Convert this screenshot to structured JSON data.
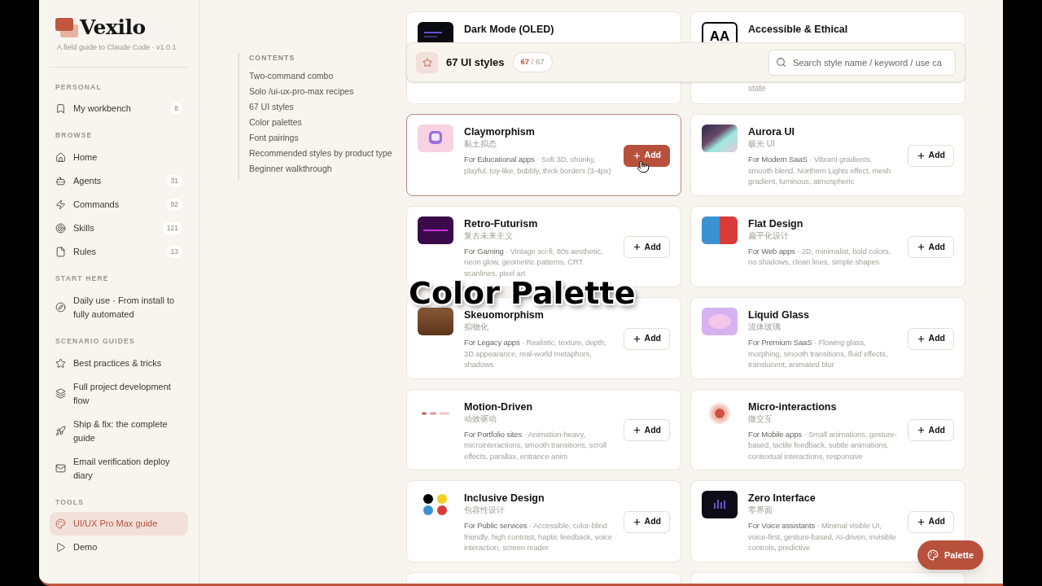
{
  "sidebar": {
    "logo": "Vexilo",
    "tagline": "A field guide to Claude Code · v1.0.1",
    "sections": [
      {
        "label": "PERSONAL",
        "items": [
          {
            "label": "My workbench",
            "count": "8",
            "selected": false
          }
        ]
      },
      {
        "label": "BROWSE",
        "items": [
          {
            "label": "Home",
            "selected": false
          },
          {
            "label": "Agents",
            "count": "31",
            "selected": false
          },
          {
            "label": "Commands",
            "count": "92",
            "selected": false
          },
          {
            "label": "Skills",
            "count": "121",
            "selected": false
          },
          {
            "label": "Rules",
            "count": "13",
            "selected": false
          }
        ]
      },
      {
        "label": "START HERE",
        "items": [
          {
            "label": "Daily use · From install to fully automated",
            "selected": false
          }
        ]
      },
      {
        "label": "SCENARIO GUIDES",
        "items": [
          {
            "label": "Best practices & tricks",
            "selected": false
          },
          {
            "label": "Full project development flow",
            "selected": false
          },
          {
            "label": "Ship & fix: the complete guide",
            "selected": false
          },
          {
            "label": "Email verification deploy diary",
            "selected": false
          }
        ]
      },
      {
        "label": "TOOLS",
        "items": [
          {
            "label": "UI/UX Pro Max guide",
            "selected": true
          },
          {
            "label": "Demo",
            "selected": false
          }
        ]
      }
    ]
  },
  "contents": {
    "title": "CONTENTS",
    "items": [
      "Two-command combo",
      "Solo /ui-ux-pro-max recipes",
      "67 UI styles",
      "Color palettes",
      "Font pairings",
      "Recommended styles by product type",
      "Beginner walkthrough"
    ]
  },
  "header": {
    "title": "67 UI styles",
    "shown": "67",
    "total": "/ 67",
    "search": {
      "placeholder": "Search style name / keyword / use ca"
    }
  },
  "top_cards": [
    {
      "name": "Dark Mode (OLED)"
    },
    {
      "name": "Accessible & Ethical",
      "badge": "AA",
      "tail": "state"
    }
  ],
  "styles": [
    {
      "name": "Claymorphism",
      "cn": "黏土拟态",
      "use": "For Educational apps",
      "traits": "· Soft 3D, chunky, playful, toy-like, bubbly, thick borders (3-4px)",
      "button": "Add",
      "hovered": true
    },
    {
      "name": "Aurora UI",
      "cn": "极光 UI",
      "use": "For Modern SaaS",
      "traits": "· Vibrant gradients, smooth blend, Northern Lights effect, mesh gradient, luminous, atmospheric",
      "button": "Add",
      "hovered": false
    },
    {
      "name": "Retro-Futurism",
      "cn": "复古未来主义",
      "use": "For Gaming",
      "traits": "· Vintage sci-fi, 80s aesthetic, neon glow, geometric patterns, CRT scanlines, pixel art",
      "button": "Add",
      "hovered": false
    },
    {
      "name": "Flat Design",
      "cn": "扁平化设计",
      "use": "For Web apps",
      "traits": "· 2D, minimalist, bold colors, no shadows, clean lines, simple shapes",
      "button": "Add",
      "hovered": false
    },
    {
      "name": "Skeuomorphism",
      "cn": "拟物化",
      "use": "For Legacy apps",
      "traits": "· Realistic, texture, depth, 3D appearance, real-world metaphors, shadows",
      "button": "Add",
      "hovered": false
    },
    {
      "name": "Liquid Glass",
      "cn": "流体玻璃",
      "use": "For Premium SaaS",
      "traits": "· Flowing glass, morphing, smooth transitions, fluid effects, translucent, animated blur",
      "button": "Add",
      "hovered": false
    },
    {
      "name": "Motion-Driven",
      "cn": "动效驱动",
      "use": "For Portfolio sites",
      "traits": "· Animation-heavy, microinteractions, smooth transitions, scroll effects, parallax, entrance anim",
      "button": "Add",
      "hovered": false
    },
    {
      "name": "Micro-interactions",
      "cn": "微交互",
      "use": "For Mobile apps",
      "traits": "· Small animations, gesture-based, tactile feedback, subtle animations, contextual interactions, responsive",
      "button": "Add",
      "hovered": false
    },
    {
      "name": "Inclusive Design",
      "cn": "包容性设计",
      "use": "For Public services",
      "traits": "· Accessible, color-blind friendly, high contrast, haptic feedback, voice interaction, screen reader",
      "button": "Add",
      "hovered": false
    },
    {
      "name": "Zero Interface",
      "cn": "零界面",
      "use": "For Voice assistants",
      "traits": "· Minimal visible UI, voice-first, gesture-based, AI-driven, invisible controls, predictive",
      "button": "Add",
      "hovered": false
    }
  ],
  "fab": "Palette",
  "caption": "Color Palette"
}
